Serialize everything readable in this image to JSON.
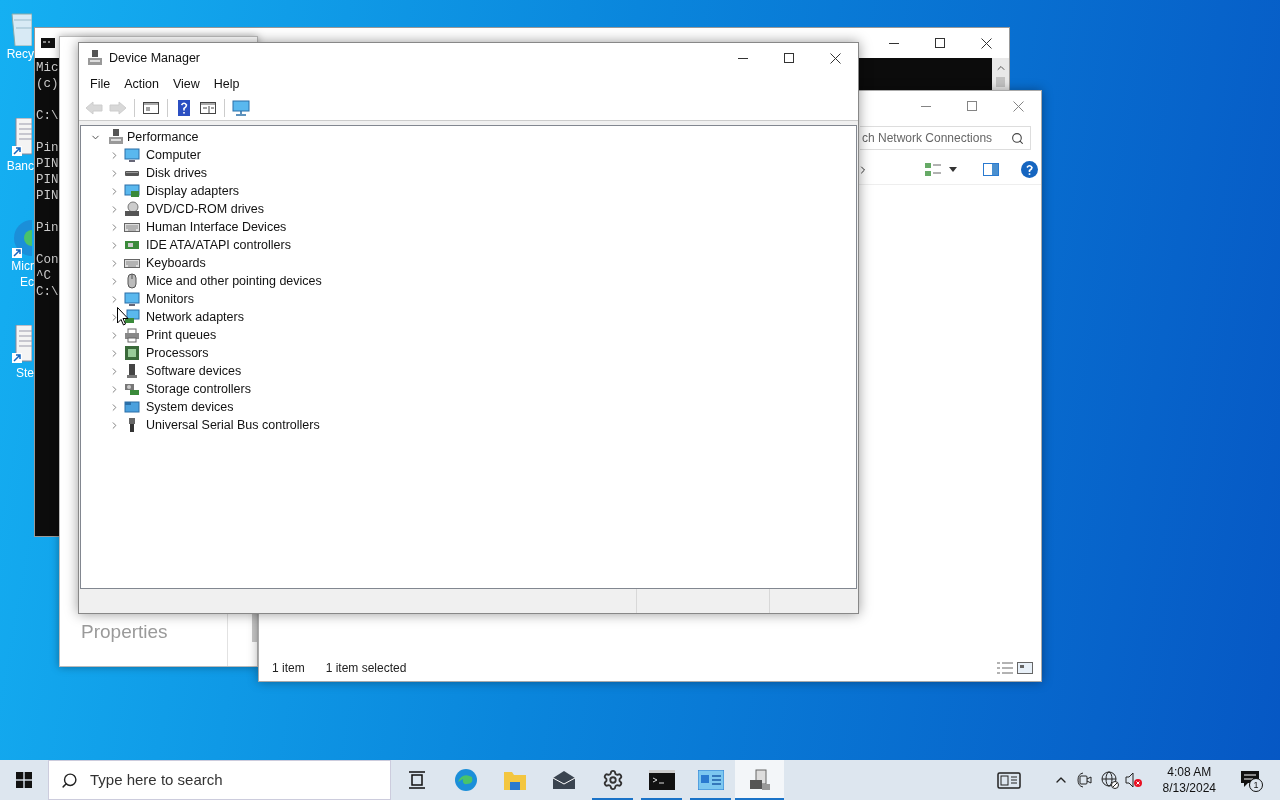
{
  "desktop_icons": [
    {
      "lines": [
        "Recy"
      ]
    },
    {
      "lines": [
        "Banc"
      ]
    },
    {
      "lines": [
        "Micr",
        "Ec"
      ]
    },
    {
      "lines": [
        "Ste"
      ]
    }
  ],
  "console_window": {
    "blocks": [
      [
        "Mic",
        "(c)"
      ],
      [
        "C:\\"
      ],
      [
        "Pin",
        "PIN",
        "PIN",
        "PIN"
      ],
      [
        "Pin"
      ],
      [
        "Con",
        "^C",
        "C:\\"
      ]
    ]
  },
  "settings_window": {
    "link": "Properties"
  },
  "network_window": {
    "search": {
      "placeholder": "ch Network Connections"
    },
    "status_bar": [
      "1 item",
      "1 item selected"
    ]
  },
  "device_manager": {
    "title": "Device Manager",
    "menu": [
      "File",
      "Action",
      "View",
      "Help"
    ],
    "toolbar": [
      {
        "disabled": true
      },
      {
        "disabled": true
      },
      {
        "disabled": false
      },
      {
        "disabled": false
      },
      {
        "disabled": false
      },
      {
        "disabled": false
      }
    ],
    "tree": {
      "label": "Performance",
      "expanded": true,
      "children": [
        {
          "label": "Computer",
          "expanded": false
        },
        {
          "label": "Disk drives",
          "expanded": false
        },
        {
          "label": "Display adapters",
          "expanded": false
        },
        {
          "label": "DVD/CD-ROM drives",
          "expanded": false
        },
        {
          "label": "Human Interface Devices",
          "expanded": false
        },
        {
          "label": "IDE ATA/ATAPI controllers",
          "expanded": false
        },
        {
          "label": "Keyboards",
          "expanded": false
        },
        {
          "label": "Mice and other pointing devices",
          "expanded": false
        },
        {
          "label": "Monitors",
          "expanded": false
        },
        {
          "label": "Network adapters",
          "expanded": false
        },
        {
          "label": "Print queues",
          "expanded": false
        },
        {
          "label": "Processors",
          "expanded": false
        },
        {
          "label": "Software devices",
          "expanded": false
        },
        {
          "label": "Storage controllers",
          "expanded": false
        },
        {
          "label": "System devices",
          "expanded": false
        },
        {
          "label": "Universal Serial Bus controllers",
          "expanded": false
        }
      ]
    }
  },
  "taskbar": {
    "search": {
      "placeholder": "Type here to search"
    },
    "apps": [
      {
        "running": false,
        "selected": false
      },
      {
        "running": false,
        "selected": false
      },
      {
        "running": false,
        "selected": false
      },
      {
        "running": false,
        "selected": false
      },
      {
        "running": true,
        "selected": false
      },
      {
        "running": true,
        "selected": false
      },
      {
        "running": true,
        "selected": false
      },
      {
        "running": true,
        "selected": true
      }
    ],
    "clock": {
      "time": "4:08 AM",
      "date": "8/13/2024"
    },
    "notifications": "1"
  }
}
